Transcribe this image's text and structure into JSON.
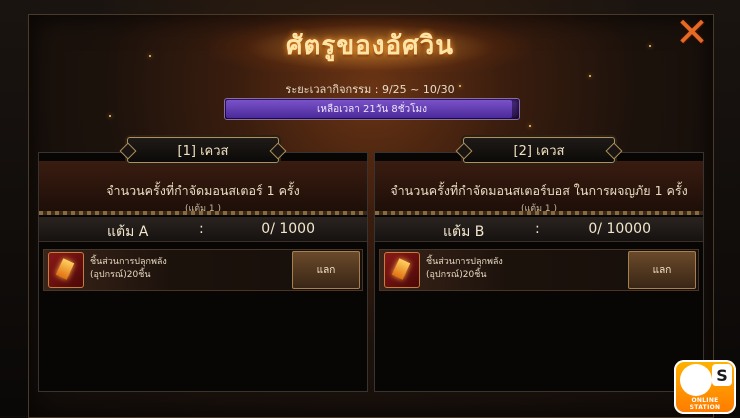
{
  "window": {
    "title": "ศัตรูของอัศวิน",
    "close_symbol": "✕",
    "period": "ระยะเวลากิจกรรม : 9/25 ~ 10/30",
    "remaining": "เหลือเวลา 21วัน 8ชั่วโมง",
    "remaining_fraction": 0.98
  },
  "quests": [
    {
      "tab": "[1] เควส",
      "description": "จำนวนครั้งที่กำจัดมอนสเตอร์ 1 ครั้ง",
      "sub": "(แต้ม 1 )",
      "score_label": "แต้ม A",
      "score_colon": ":",
      "score_value": "0/ 1000",
      "reward_line1": "ชิ้นส่วนการปลุกพลัง",
      "reward_line2": "(อุปกรณ์)20ชิ้น",
      "exchange_label": "แลก"
    },
    {
      "tab": "[2] เควส",
      "description": "จำนวนครั้งที่กำจัดมอนสเตอร์บอส ในการผจญภัย 1 ครั้ง",
      "sub": "(แต้ม 1 )",
      "score_label": "แต้ม B",
      "score_colon": ":",
      "score_value": "0/ 10000",
      "reward_line1": "ชิ้นส่วนการปลุกพลัง",
      "reward_line2": "(อุปกรณ์)20ชิ้น",
      "exchange_label": "แลก"
    }
  ],
  "watermark": {
    "letter": "S",
    "text": "ONLINE STATION"
  }
}
